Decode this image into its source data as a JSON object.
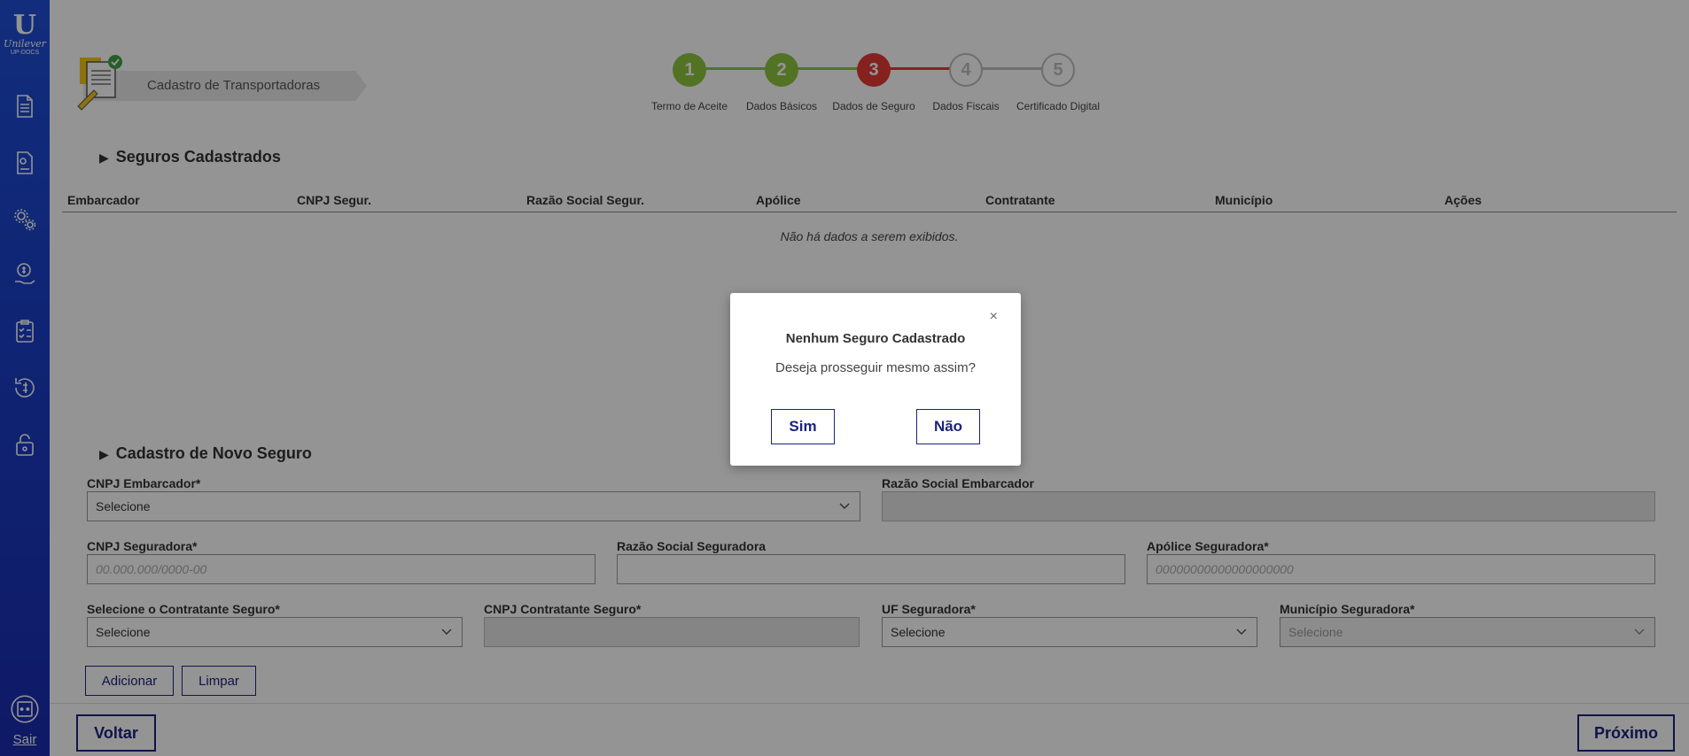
{
  "app": {
    "brand": "Unilever",
    "brand_sub": "UP-DOCS",
    "page_title": "Cadastro de Transportadoras",
    "exit_label": "Sair"
  },
  "sidebar": {
    "items": [
      {
        "icon": "document-icon"
      },
      {
        "icon": "settings-document-icon"
      },
      {
        "icon": "gears-icon"
      },
      {
        "icon": "money-hand-icon"
      },
      {
        "icon": "checklist-icon"
      },
      {
        "icon": "refund-icon"
      },
      {
        "icon": "lock-icon"
      }
    ]
  },
  "stepper": {
    "steps": [
      {
        "number": "1",
        "label": "Termo de Aceite",
        "status": "done"
      },
      {
        "number": "2",
        "label": "Dados Básicos",
        "status": "done"
      },
      {
        "number": "3",
        "label": "Dados de Seguro",
        "status": "current"
      },
      {
        "number": "4",
        "label": "Dados Fiscais",
        "status": "pending"
      },
      {
        "number": "5",
        "label": "Certificado Digital",
        "status": "pending"
      }
    ],
    "colors": {
      "done": "#8dc63f",
      "current": "#e53935",
      "pending": "#bdbdbd"
    }
  },
  "seguros": {
    "title": "Seguros Cadastrados",
    "columns": [
      "Embarcador",
      "CNPJ Segur.",
      "Razão Social Segur.",
      "Apólice",
      "Contratante",
      "Município",
      "Ações"
    ],
    "empty_message": "Não há dados a serem exibidos."
  },
  "novo": {
    "title": "Cadastro de Novo Seguro",
    "cnpj_embarcador": {
      "label": "CNPJ Embarcador*",
      "value": "Selecione"
    },
    "razao_embarcador": {
      "label": "Razão Social Embarcador",
      "value": ""
    },
    "cnpj_seguradora": {
      "label": "CNPJ Seguradora*",
      "placeholder": "00.000.000/0000-00"
    },
    "razao_seguradora": {
      "label": "Razão Social Seguradora",
      "value": ""
    },
    "apolice": {
      "label": "Apólice Seguradora*",
      "placeholder": "00000000000000000000"
    },
    "contratante": {
      "label": "Selecione o Contratante Seguro*",
      "value": "Selecione"
    },
    "cnpj_contratante": {
      "label": "CNPJ Contratante Seguro*",
      "value": ""
    },
    "uf": {
      "label": "UF Seguradora*",
      "value": "Selecione"
    },
    "municipio": {
      "label": "Município Seguradora*",
      "value": "Selecione"
    },
    "add_label": "Adicionar",
    "clear_label": "Limpar"
  },
  "footer": {
    "back_label": "Voltar",
    "next_label": "Próximo"
  },
  "modal": {
    "title": "Nenhum Seguro Cadastrado",
    "message": "Deseja prosseguir mesmo assim?",
    "yes_label": "Sim",
    "no_label": "Não",
    "close_glyph": "×"
  }
}
